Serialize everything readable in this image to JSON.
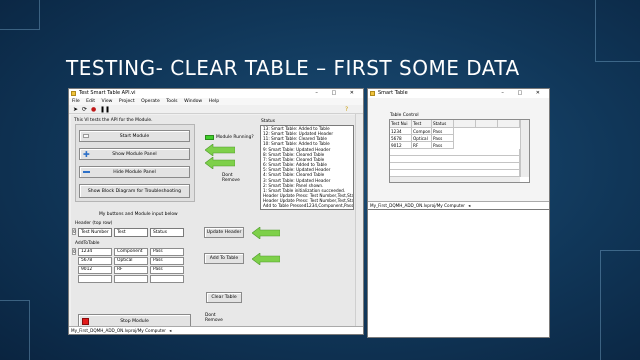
{
  "slide": {
    "title": "TESTING- CLEAR TABLE – FIRST SOME DATA"
  },
  "api_window": {
    "title": "Test Smart Table API.vi",
    "menu": [
      "File",
      "Edit",
      "View",
      "Project",
      "Operate",
      "Tools",
      "Window",
      "Help"
    ],
    "description": "This VI tests the API for the Module.",
    "start_module": "Start Module",
    "show_module_panel": "Show Module Panel",
    "hide_module_panel": "Hide Module Panel",
    "show_block_diagram": "Show Block Diagram for Troubleshooting",
    "module_running_label": "Module Running?",
    "dont_remove_1": [
      "Dont",
      "Remove"
    ],
    "my_buttons_label": "My buttons and Module input below",
    "status_label": "Status",
    "status_lines": [
      "13: Smart Table: Added to Table",
      "12: Smart Table: Updated Header",
      "11: Smart Table: Cleared Table",
      "10: Smart Table: Added to Table",
      "9: Smart Table: Updated Header",
      "8: Smart Table: Cleared Table",
      "7: Smart Table: Cleared Table",
      "6: Smart Table: Added to Table",
      "5: Smart Table: Updated Header",
      "4: Smart Table: Cleared Table",
      "3: Smart Table: Updated Header",
      "2: Smart Table: Panel shown.",
      "1: Smart Table initialization succeeded.",
      "Header Update Press: Test Number,Test,Status",
      "Header Update Press: Test Number,Test,Status",
      "Add to Table Pressed1234,Component,Pass"
    ],
    "header_label": "Header (top row)",
    "header_index": "0",
    "header_values": [
      "Test Number",
      "Test",
      "Status"
    ],
    "update_header": "Update Header",
    "add_to_table_label": "AddToTable",
    "add_index": "0",
    "add_rows": [
      [
        "1234",
        "Component",
        "Pass"
      ],
      [
        "5678",
        "Optical",
        "Pass"
      ],
      [
        "9012",
        "RF",
        "Pass"
      ]
    ],
    "add_to_table": "Add To Table",
    "clear_table": "Clear Table",
    "stop_module": "Stop Module",
    "dont_remove_2": [
      "Dont",
      "Remove"
    ],
    "path": "My_First_DQMH_ADD_ON.lvproj/My Computer"
  },
  "smart_table_window": {
    "title": "Smart Table",
    "table_control_label": "Table Control",
    "headers": [
      "Test Nui",
      "Test",
      "Status"
    ],
    "rows": [
      [
        "1234",
        "Compon",
        "Pass"
      ],
      [
        "5678",
        "Optical",
        "Pass"
      ],
      [
        "9012",
        "RF",
        "Pass"
      ]
    ],
    "path": "My_First_DQMH_ADD_ON.lvproj/My Computer"
  },
  "colors": {
    "led": "#3fce2b",
    "arrow": "#7ed04a",
    "stop": "#e21b1b",
    "background": "#103658"
  }
}
